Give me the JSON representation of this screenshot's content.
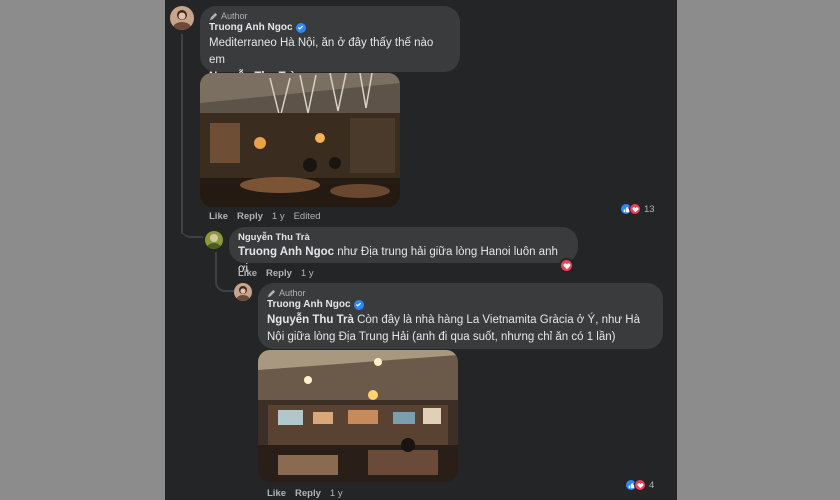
{
  "comment1": {
    "author_tag": "Author",
    "name": "Truong Anh Ngoc",
    "text": "Mediterraneo Hà Nội, ăn ở đây thấy thế nào em",
    "mention": "Nguyễn Thu Trà",
    "actions": {
      "like": "Like",
      "reply": "Reply",
      "time": "1 y",
      "edited": "Edited"
    },
    "reaction_count": "13"
  },
  "reply1": {
    "name": "Nguyễn Thu Trà",
    "mention": "Truong Anh Ngoc",
    "text": " như Địa trung hải giữa lòng Hanoi luôn anh ơi",
    "actions": {
      "like": "Like",
      "reply": "Reply",
      "time": "1 y"
    }
  },
  "reply2": {
    "author_tag": "Author",
    "name": "Truong Anh Ngoc",
    "mention": "Nguyễn Thu Trà",
    "text": " Còn đây là nhà hàng La Vietnamita Gràcia ở Ý, như Hà Nội giữa lòng Địa Trung Hải (anh đi qua suốt, nhưng chỉ ăn có 1 lần)",
    "actions": {
      "like": "Like",
      "reply": "Reply",
      "time": "1 y"
    },
    "reaction_count": "4"
  },
  "colors": {
    "background": "#8c8c8c",
    "panel": "#242526",
    "bubble": "#3a3b3c",
    "text": "#e4e6eb",
    "secondary_text": "#b0b3b8",
    "like_blue": "#2d88ff",
    "love_red": "#f33e58"
  },
  "icons": [
    "pencil-icon",
    "verified-badge-icon",
    "like-reaction-icon",
    "love-reaction-icon"
  ]
}
